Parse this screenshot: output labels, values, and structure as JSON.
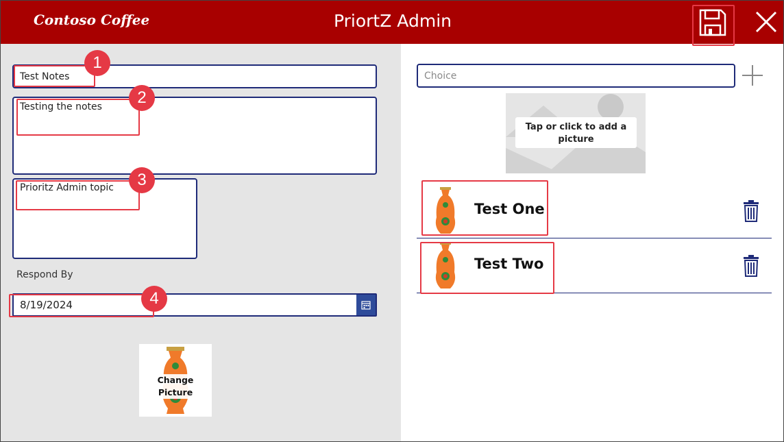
{
  "app": {
    "logo_text": "Contoso Coffee",
    "title": "PriortZ Admin",
    "header_color": "#a80000",
    "accent_color": "#1e2a78",
    "highlight_color": "#e53945"
  },
  "header": {
    "save_icon": "save-icon",
    "close_icon": "close-icon"
  },
  "form": {
    "notes_title": "Test Notes",
    "notes_body": "Testing the notes",
    "topic": "Prioritz Admin topic",
    "respond_by_label": "Respond By",
    "respond_by_value": "8/19/2024",
    "change_picture_label": "Change Picture"
  },
  "choices": {
    "placeholder": "Choice",
    "add_picture_label": "Tap or click to add a picture",
    "items": [
      {
        "label": "Test One"
      },
      {
        "label": "Test Two"
      }
    ]
  },
  "callouts": [
    "1",
    "2",
    "3",
    "4"
  ]
}
